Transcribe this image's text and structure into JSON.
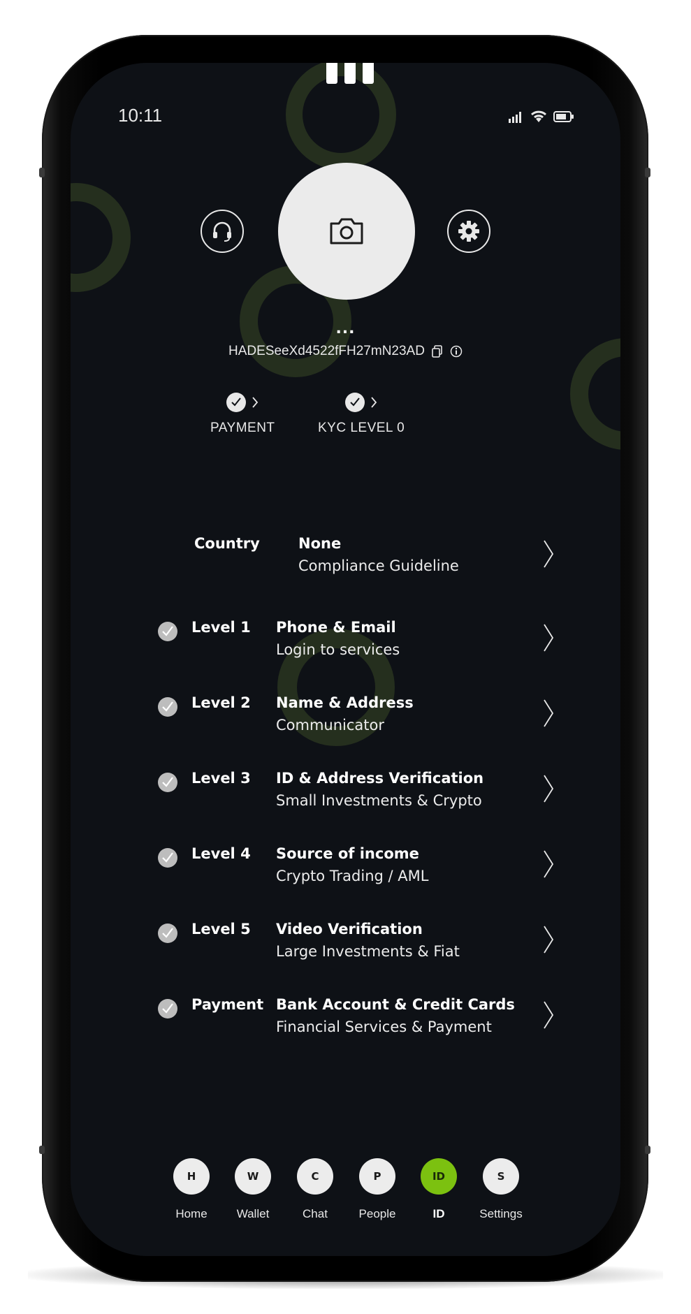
{
  "status_bar": {
    "time": "10:11"
  },
  "profile": {
    "name_placeholder": "...",
    "address": "HADESeeXd4522fFH27mN23AD"
  },
  "status_pills": [
    {
      "label": "PAYMENT"
    },
    {
      "label": "KYC LEVEL 0"
    }
  ],
  "country_row": {
    "label": "Country",
    "title": "None",
    "subtitle": "Compliance Guideline"
  },
  "levels": [
    {
      "label": "Level 1",
      "title": "Phone & Email",
      "subtitle": "Login to services",
      "checked": true
    },
    {
      "label": "Level 2",
      "title": "Name & Address",
      "subtitle": "Communicator",
      "checked": true
    },
    {
      "label": "Level 3",
      "title": "ID & Address Verification",
      "subtitle": "Small Investments & Crypto",
      "checked": true
    },
    {
      "label": "Level 4",
      "title": "Source of income",
      "subtitle": "Crypto Trading / AML",
      "checked": true
    },
    {
      "label": "Level 5",
      "title": "Video Verification",
      "subtitle": "Large Investments & Fiat",
      "checked": true
    },
    {
      "label": "Payment",
      "title": "Bank Account & Credit Cards",
      "subtitle": "Financial Services & Payment",
      "checked": true
    }
  ],
  "nav": [
    {
      "letter": "H",
      "label": "Home",
      "active": false
    },
    {
      "letter": "W",
      "label": "Wallet",
      "active": false
    },
    {
      "letter": "C",
      "label": "Chat",
      "active": false
    },
    {
      "letter": "P",
      "label": "People",
      "active": false
    },
    {
      "letter": "ID",
      "label": "ID",
      "active": true
    },
    {
      "letter": "S",
      "label": "Settings",
      "active": false
    }
  ],
  "colors": {
    "accent": "#7cc110",
    "screen_bg": "#0e1116",
    "ring": "#252f1e"
  },
  "icons": [
    "headset-icon",
    "camera-icon",
    "gear-icon",
    "copy-icon",
    "info-icon",
    "check-icon",
    "chevron-right-icon",
    "signal-icon",
    "wifi-icon",
    "battery-icon"
  ]
}
